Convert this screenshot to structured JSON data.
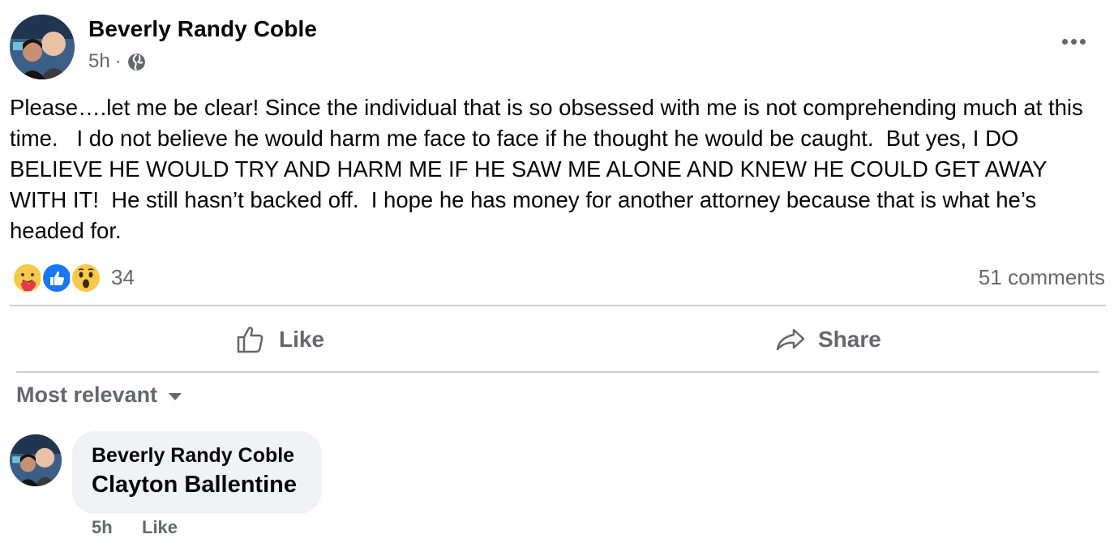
{
  "post": {
    "author": "Beverly Randy Coble",
    "time": "5h",
    "separator": "·",
    "privacy_icon": "globe-icon",
    "text": "Please….let me be clear! Since the individual that is so obsessed with me is not comprehending much at this time.   I do not believe he would harm me face to face if he thought he would be caught.  But yes, I DO BELIEVE HE WOULD TRY AND HARM ME IF HE SAW ME ALONE AND KNEW HE COULD GET AWAY WITH IT!  He still hasn’t backed off.  I hope he has money for another attorney because that is what he’s headed for.",
    "reactions": [
      "care",
      "like",
      "wow"
    ],
    "reaction_count": "34",
    "comment_count": "51 comments"
  },
  "actions": {
    "like_label": "Like",
    "share_label": "Share"
  },
  "comments_section": {
    "sort_label": "Most relevant",
    "comments": [
      {
        "author": "Beverly Randy Coble",
        "text": "Clayton Ballentine",
        "time": "5h",
        "like_label": "Like"
      }
    ]
  },
  "colors": {
    "text_primary": "#050505",
    "text_secondary": "#65676b",
    "divider": "#ced0d4",
    "bubble": "#f0f2f5",
    "like_blue": "#1877f2"
  }
}
